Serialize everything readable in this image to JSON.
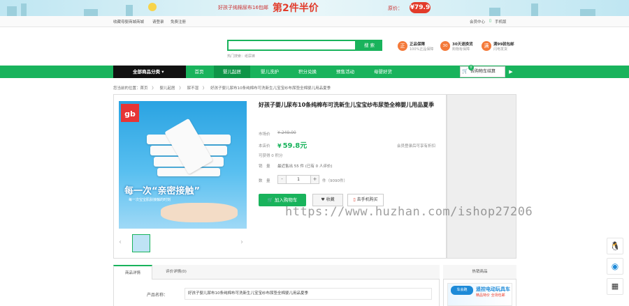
{
  "banner": {
    "promo_text": "好孩子纯棉尿布16包邮",
    "big_text": "第2件半价",
    "price_label": "原价：",
    "price_value": "¥79.9"
  },
  "topbar": {
    "favorite": "收藏母婴商城商城",
    "login": "请登录",
    "register": "免费注册",
    "member_center": "会员中心",
    "mobile": "手机版"
  },
  "search": {
    "placeholder": "",
    "button": "搜 索",
    "hot_label": "热门搜索：",
    "hot_word": "纸尿裤"
  },
  "guarantees": [
    {
      "icon": "正",
      "title": "正品保障",
      "sub": "100%正品保障"
    },
    {
      "icon": "30",
      "title": "30天退换货",
      "sub": "购物有保障"
    },
    {
      "icon": "满",
      "title": "满99就包邮",
      "sub": "闪电发货"
    }
  ],
  "nav": {
    "category_button": "全部商品分类",
    "items": [
      "首页",
      "婴儿起居",
      "婴儿洗护",
      "积分兑换",
      "预售活动",
      "母婴好货"
    ],
    "active_index": 1,
    "cart_label": "去购物车结算",
    "cart_count": "0",
    "cart_arrow": "▶"
  },
  "breadcrumb": [
    "您当前的位置：首页",
    "〉",
    "婴儿起居",
    "〉",
    "尿不湿",
    "〉",
    "好孩子婴儿尿布10条纯棉布可洗新生儿宝宝纱布尿垫全棉婴儿用品夏季"
  ],
  "product": {
    "brand_logo": "gb",
    "brand_name": "好孩子",
    "image_slogan": "每一次“亲密接触”",
    "image_subtext": "每一次宝宝肌肤接触的时刻",
    "title": "好孩子婴儿尿布10条纯棉布可洗新生儿宝宝纱布尿垫全棉婴儿用品夏季",
    "market_price_label": "市场价",
    "market_price": "¥ 249.00",
    "our_price_label": "本店价",
    "price": "59.8元",
    "price_currency": "¥",
    "login_hint": "会员登录后可享有折扣",
    "points": "可获得 0 积分",
    "sales_label": "销　量",
    "sales_value": "最近售出 55 件 (已有 0 人评价)",
    "qty_label": "数　量",
    "qty_value": "1",
    "qty_minus": "-",
    "qty_plus": "+",
    "stock": "件（9090件）",
    "add_cart": "加入购物车",
    "favorite": "收藏",
    "mobile_buy": "去手机购买",
    "thumb_prev": "‹",
    "thumb_next": "›"
  },
  "watermark": "https://www.huzhan.com/ishop27206",
  "tabs": {
    "items": [
      "商品详情",
      "评价详情(0)"
    ],
    "active_index": 0,
    "name_label": "产品名称：",
    "name_value": "好孩子婴儿尿布10条纯棉布可洗新生儿宝宝纱布尿垫全棉婴儿用品夏季"
  },
  "hot_products": {
    "title": "热销商品",
    "item_title": "遥控电动玩具车",
    "item_sub": "精品特价 全场包邮",
    "item_logo": "车会跑"
  },
  "sidebar_icons": [
    "qq-icon",
    "service-icon",
    "qrcode-icon"
  ],
  "colors": {
    "accent": "#19b35c",
    "price": "#19b35c",
    "banner_red": "#e23b2a"
  }
}
